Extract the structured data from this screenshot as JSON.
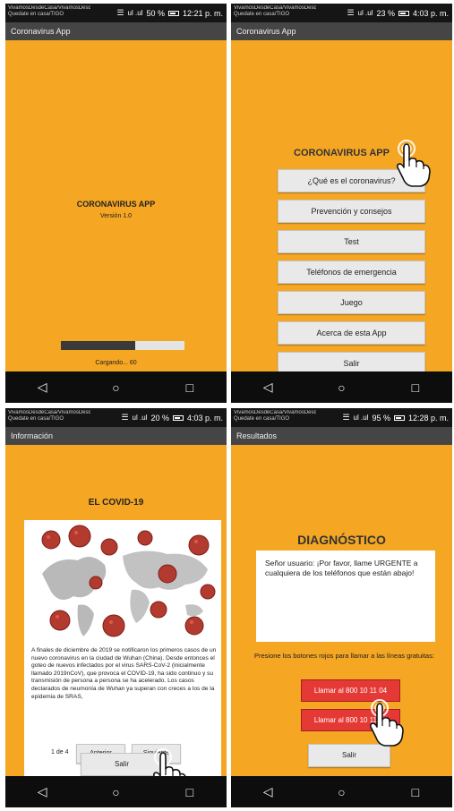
{
  "status": {
    "carrier_line1": "VivamosDesdeCasa/VivamosDesdeCasa",
    "carrier_line2": "Quedate en casa/TIGO",
    "signal": "ul .ul",
    "screens": [
      {
        "battery": "50 %",
        "time": "12:21 p. m."
      },
      {
        "battery": "23 %",
        "time": "4:03 p. m."
      },
      {
        "battery": "20 %",
        "time": "4:03 p. m."
      },
      {
        "battery": "95 %",
        "time": "12:28 p. m."
      }
    ]
  },
  "splash": {
    "titlebar": "Coronavirus App",
    "title": "CORONAVIRUS APP",
    "version": "Versión 1.0",
    "progress_value": 0.6,
    "progress_text": "Cargando... 60"
  },
  "menu": {
    "titlebar": "Coronavirus App",
    "title": "CORONAVIRUS APP",
    "buttons": [
      "¿Qué es el coronavirus?",
      "Prevención y consejos",
      "Test",
      "Teléfonos de emergencia",
      "Juego",
      "Acerca de esta App",
      "Salir"
    ]
  },
  "info": {
    "titlebar": "Información",
    "heading": "EL COVID-19",
    "text": "A finales de diciembre de 2019 se notificaron los primeros casos de un nuevo coronavirus en la ciudad de Wuhan (China). Desde entonces el goteo de nuevos infectados por el virus SARS-CoV-2 (inicialmente llamado 2019nCoV), que provoca el COVID-19, ha sido continuo y su transmisión de persona a persona se ha acelerado. Los casos declarados de neumonía de Wuhan ya superan con creces a los de la epidemia de SRAS,",
    "pager": "1 de 4",
    "prev_label": "Anterior",
    "next_label": "Siguiente",
    "exit_label": "Salir"
  },
  "diag": {
    "titlebar": "Resultados",
    "title": "DIAGNÓSTICO",
    "message": "Señor usuario: ¡Por favor, llame URGENTE a cualquiera de los teléfonos que están abajo!",
    "instructions": "Presione los botones rojos para llamar a las líneas gratuitas:",
    "phone1": "Llamar al 800 10 11 04",
    "phone2": "Llamar al 800 10 11 05",
    "exit_label": "Salir"
  },
  "nav": {
    "back": "◁",
    "home": "○",
    "recent": "□"
  },
  "colors": {
    "app_bg": "#f5a623",
    "status_bg": "#151515",
    "titlebar_bg": "#454545",
    "call_button": "#e53935"
  }
}
